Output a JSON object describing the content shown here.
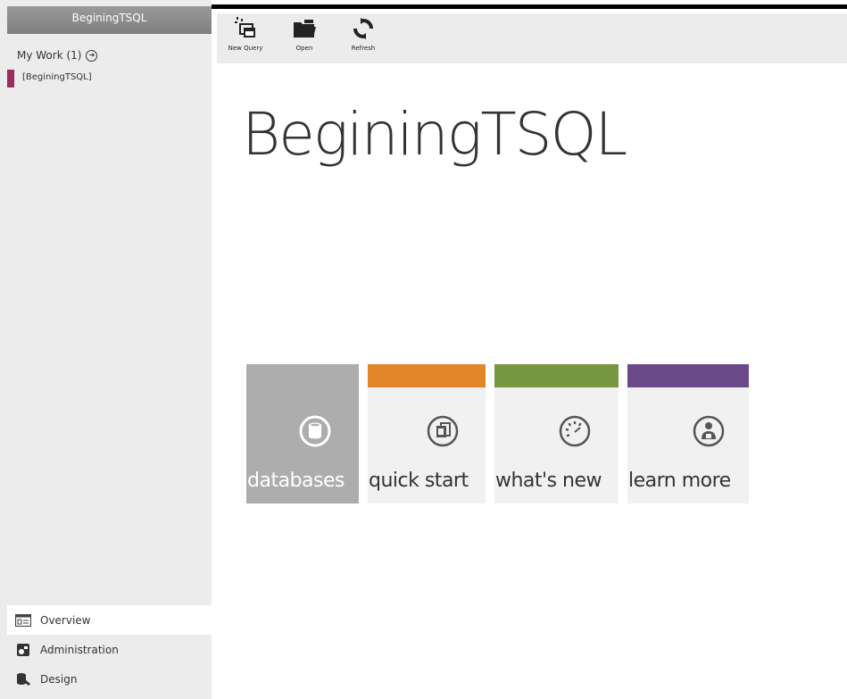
{
  "sidebar": {
    "title": "BeginingTSQL",
    "my_work_label": "My Work (1)",
    "project_label": "[BeginingTSQL]",
    "project_marker_color": "#9b2d5e",
    "nav": [
      {
        "label": "Overview",
        "icon": "overview-icon"
      },
      {
        "label": "Administration",
        "icon": "administration-icon"
      },
      {
        "label": "Design",
        "icon": "design-icon"
      }
    ]
  },
  "toolbar": {
    "new_query_label": "New Query",
    "open_label": "Open",
    "refresh_label": "Refresh"
  },
  "main": {
    "title": "BeginingTSQL"
  },
  "tiles": [
    {
      "label": "databases",
      "icon": "database-icon",
      "color": "#adadad"
    },
    {
      "label": "quick start",
      "icon": "quick-start-icon",
      "color": "#e2852b"
    },
    {
      "label": "what's new",
      "icon": "whats-new-icon",
      "color": "#76963f"
    },
    {
      "label": "learn more",
      "icon": "learn-more-icon",
      "color": "#6b4a8a"
    }
  ]
}
